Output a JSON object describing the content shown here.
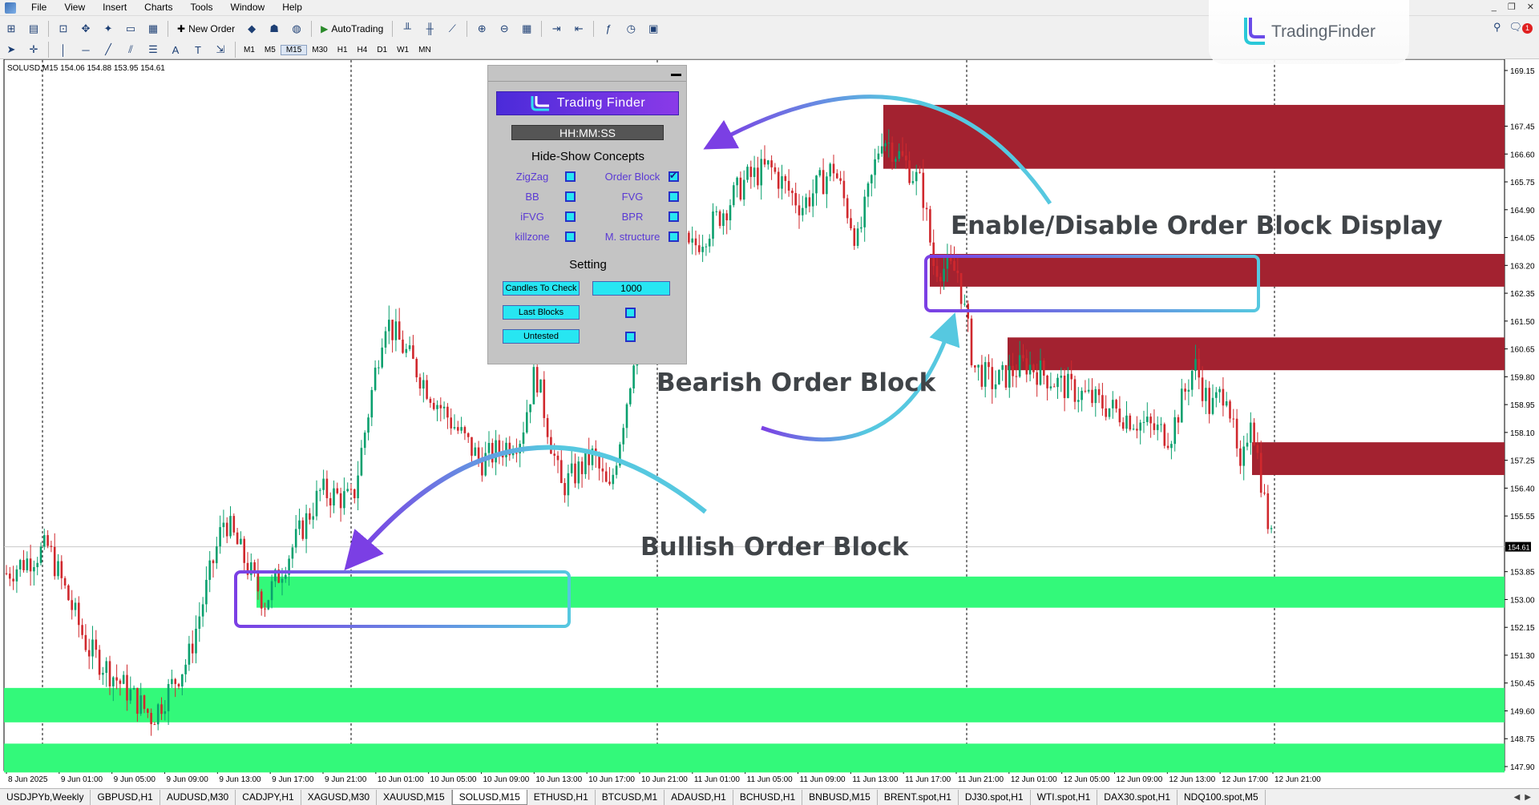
{
  "menu": [
    "File",
    "View",
    "Insert",
    "Charts",
    "Tools",
    "Window",
    "Help"
  ],
  "toolbar": {
    "new_order": "New Order",
    "auto_trading": "AutoTrading",
    "timeframes": [
      "M1",
      "M5",
      "M15",
      "M30",
      "H1",
      "H4",
      "D1",
      "W1",
      "MN"
    ],
    "active_timeframe": "M15"
  },
  "brand": {
    "name": "TradingFinder"
  },
  "notifications": {
    "count": "1"
  },
  "chart": {
    "symbol_info": "SOLUSD,M15  154.06 154.88 153.95 154.61",
    "current_price": "154.61",
    "price_labels": [
      "169.15",
      "167.45",
      "166.60",
      "165.75",
      "164.90",
      "164.05",
      "163.20",
      "162.35",
      "161.50",
      "160.65",
      "159.80",
      "158.95",
      "158.10",
      "157.25",
      "156.40",
      "155.55",
      "154.61",
      "153.85",
      "153.00",
      "152.15",
      "151.30",
      "150.45",
      "149.60",
      "148.75",
      "147.90"
    ],
    "time_labels": [
      "8 Jun 2025",
      "9 Jun 01:00",
      "9 Jun 05:00",
      "9 Jun 09:00",
      "9 Jun 13:00",
      "9 Jun 17:00",
      "9 Jun 21:00",
      "10 Jun 01:00",
      "10 Jun 05:00",
      "10 Jun 09:00",
      "10 Jun 13:00",
      "10 Jun 17:00",
      "10 Jun 21:00",
      "11 Jun 01:00",
      "11 Jun 05:00",
      "11 Jun 09:00",
      "11 Jun 13:00",
      "11 Jun 17:00",
      "11 Jun 21:00",
      "12 Jun 01:00",
      "12 Jun 05:00",
      "12 Jun 09:00",
      "12 Jun 13:00",
      "12 Jun 17:00",
      "12 Jun 21:00"
    ],
    "bearish_color": "#a32230",
    "bullish_color": "#33f97a"
  },
  "panel": {
    "brand": "Trading Finder",
    "clock": "HH:MM:SS",
    "concepts_title": "Hide-Show Concepts",
    "concepts": [
      {
        "label": "ZigZag",
        "checked": false
      },
      {
        "label": "Order Block",
        "checked": true
      },
      {
        "label": "BB",
        "checked": false
      },
      {
        "label": "FVG",
        "checked": false
      },
      {
        "label": "iFVG",
        "checked": false
      },
      {
        "label": "BPR",
        "checked": false
      },
      {
        "label": "killzone",
        "checked": false
      },
      {
        "label": "M. structure",
        "checked": false
      }
    ],
    "setting_title": "Setting",
    "candles_to_check_label": "Candles To Check",
    "candles_to_check_value": "1000",
    "last_blocks_label": "Last Blocks",
    "untested_label": "Untested"
  },
  "annotations": {
    "enable_disable": "Enable/Disable Order Block Display",
    "bearish": "Bearish Order Block",
    "bullish": "Bullish Order Block"
  },
  "tabs": [
    "USDJPYb,Weekly",
    "GBPUSD,H1",
    "AUDUSD,M30",
    "CADJPY,H1",
    "XAGUSD,M30",
    "XAUUSD,M15",
    "SOLUSD,M15",
    "ETHUSD,H1",
    "BTCUSD,M1",
    "ADAUSD,H1",
    "BCHUSD,H1",
    "BNBUSD,M15",
    "BRENT.spot,H1",
    "DJ30.spot,H1",
    "WTI.spot,H1",
    "DAX30.spot,H1",
    "NDQ100.spot,M5"
  ],
  "active_tab": "SOLUSD,M15"
}
